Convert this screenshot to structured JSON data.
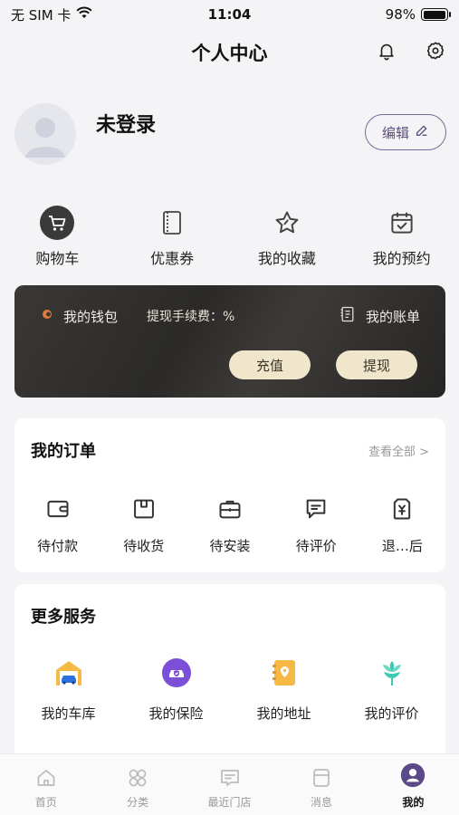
{
  "status_bar": {
    "carrier": "无 SIM 卡",
    "time": "11:04",
    "battery": "98%",
    "battery_level": 0.98
  },
  "nav": {
    "title": "个人中心"
  },
  "profile": {
    "name": "未登录",
    "edit_label": "编辑"
  },
  "quick_actions": [
    {
      "label": "购物车",
      "icon": "cart-icon"
    },
    {
      "label": "优惠券",
      "icon": "coupon-icon"
    },
    {
      "label": "我的收藏",
      "icon": "star-icon"
    },
    {
      "label": "我的预约",
      "icon": "calendar-check-icon"
    }
  ],
  "wallet": {
    "title": "我的钱包",
    "fee": "提现手续费：%",
    "bill": "我的账单",
    "recharge": "充值",
    "withdraw": "提现"
  },
  "orders": {
    "title": "我的订单",
    "more": "查看全部 >",
    "items": [
      {
        "label": "待付款",
        "icon": "wallet-icon"
      },
      {
        "label": "待收货",
        "icon": "package-icon"
      },
      {
        "label": "待安装",
        "icon": "toolbox-icon"
      },
      {
        "label": "待评价",
        "icon": "comment-icon"
      },
      {
        "label": "退…后",
        "icon": "refund-icon"
      }
    ]
  },
  "services": {
    "title": "更多服务",
    "items": [
      {
        "label": "我的车库",
        "icon": "garage-icon"
      },
      {
        "label": "我的保险",
        "icon": "insurance-icon"
      },
      {
        "label": "我的地址",
        "icon": "address-book-icon"
      },
      {
        "label": "我的评价",
        "icon": "flower-icon"
      }
    ]
  },
  "tabs": [
    {
      "label": "首页",
      "icon": "home-icon"
    },
    {
      "label": "分类",
      "icon": "category-icon"
    },
    {
      "label": "最近门店",
      "icon": "store-icon"
    },
    {
      "label": "消息",
      "icon": "message-icon"
    },
    {
      "label": "我的",
      "icon": "profile-icon",
      "active": true
    }
  ],
  "colors": {
    "accent": "#5d4d7c",
    "wallet_bg": "#2e2d2b",
    "wallet_button": "#efe6cc",
    "background": "#f4f4f6"
  }
}
